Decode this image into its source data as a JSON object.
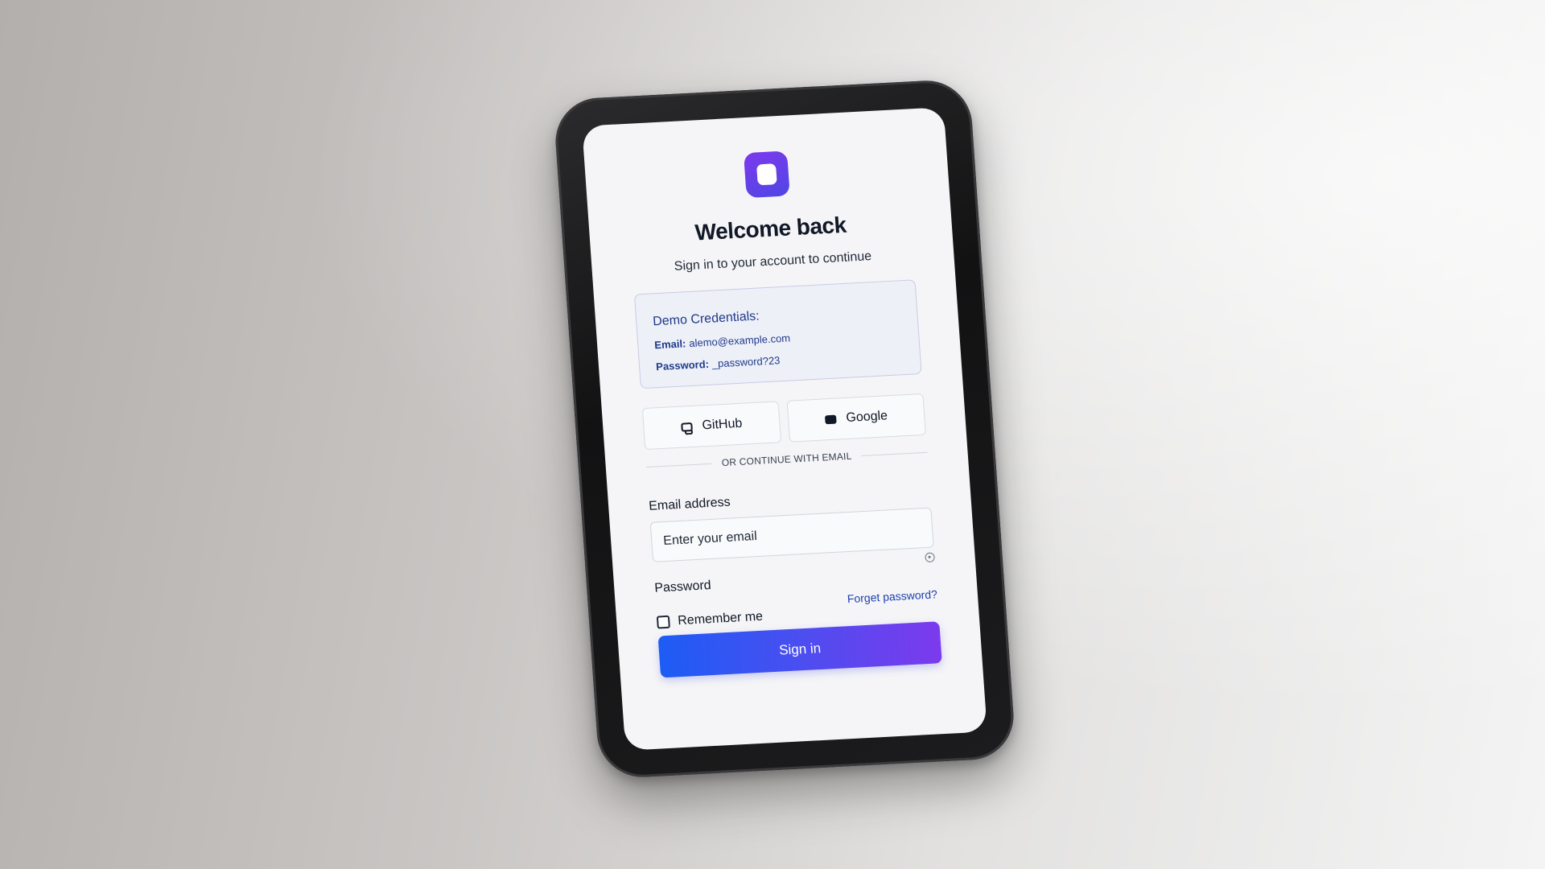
{
  "auth": {
    "title": "Welcome back",
    "subtitle": "Sign in to your account to continue"
  },
  "demo": {
    "heading": "Demo Credentials:",
    "email_label": "Email:",
    "email_value": "alemo@example.com",
    "password_label": "Password:",
    "password_value": "_password?23"
  },
  "social": {
    "github_label": "GitHub",
    "google_label": "Google",
    "github_icon": "github-icon",
    "google_icon": "google-icon"
  },
  "divider": {
    "text": "OR CONTINUE WITH EMAIL"
  },
  "form": {
    "email_label": "Email address",
    "email_placeholder": "Enter your email",
    "email_value": "",
    "password_label": "Password",
    "remember_label": "Remember me",
    "remember_checked": false,
    "forgot_label": "Forget password?",
    "submit_label": "Sign in"
  },
  "colors": {
    "accent_start": "#1d5cf5",
    "accent_end": "#7c3aed",
    "logo": "#6d28d9",
    "link": "#1e40af"
  }
}
